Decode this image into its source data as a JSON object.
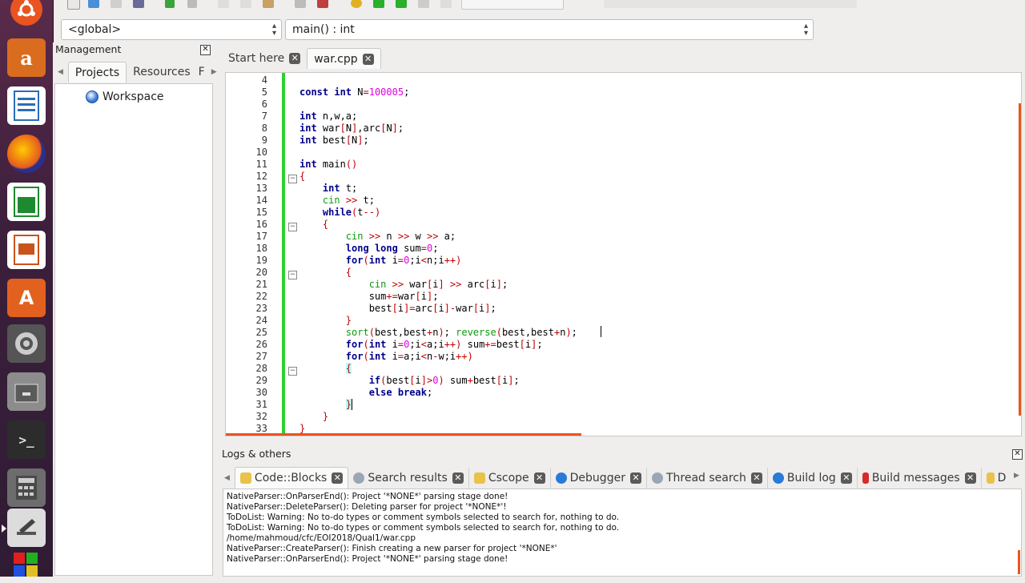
{
  "toolbar": {
    "scope_combo": "<global>",
    "function_combo": "main() : int"
  },
  "management": {
    "title": "Management",
    "tabs": [
      "Projects",
      "Resources",
      "F"
    ],
    "workspace": "Workspace"
  },
  "editor": {
    "tabs": [
      {
        "label": "Start here"
      },
      {
        "label": "war.cpp"
      }
    ],
    "line_numbers": [
      "4",
      "5",
      "6",
      "7",
      "8",
      "9",
      "10",
      "11",
      "12",
      "13",
      "14",
      "15",
      "16",
      "17",
      "18",
      "19",
      "20",
      "21",
      "22",
      "23",
      "24",
      "25",
      "26",
      "27",
      "28",
      "29",
      "30",
      "31",
      "32",
      "33"
    ]
  },
  "logs": {
    "title": "Logs & others",
    "tabs": [
      "Code::Blocks",
      "Search results",
      "Cscope",
      "Debugger",
      "Thread search",
      "Build log",
      "Build messages",
      "D"
    ],
    "lines": [
      "NativeParser::OnParserEnd(): Project '*NONE*' parsing stage done!",
      "NativeParser::DeleteParser(): Deleting parser for project '*NONE*'!",
      "ToDoList: Warning: No to-do types or comment symbols selected to search for, nothing to do.",
      "ToDoList: Warning: No to-do types or comment symbols selected to search for, nothing to do.",
      "/home/mahmoud/cfc/EOI2018/Qual1/war.cpp",
      "NativeParser::CreateParser(): Finish creating a new parser for project '*NONE*'",
      "NativeParser::OnParserEnd(): Project '*NONE*' parsing stage done!"
    ]
  },
  "colors": {
    "launcher_bg": "#3c1f3c",
    "accent": "#e95420",
    "change_bar": "#2fd12f",
    "keyword": "#00008b",
    "number": "#e000e0",
    "stream": "#0d9a0d"
  }
}
